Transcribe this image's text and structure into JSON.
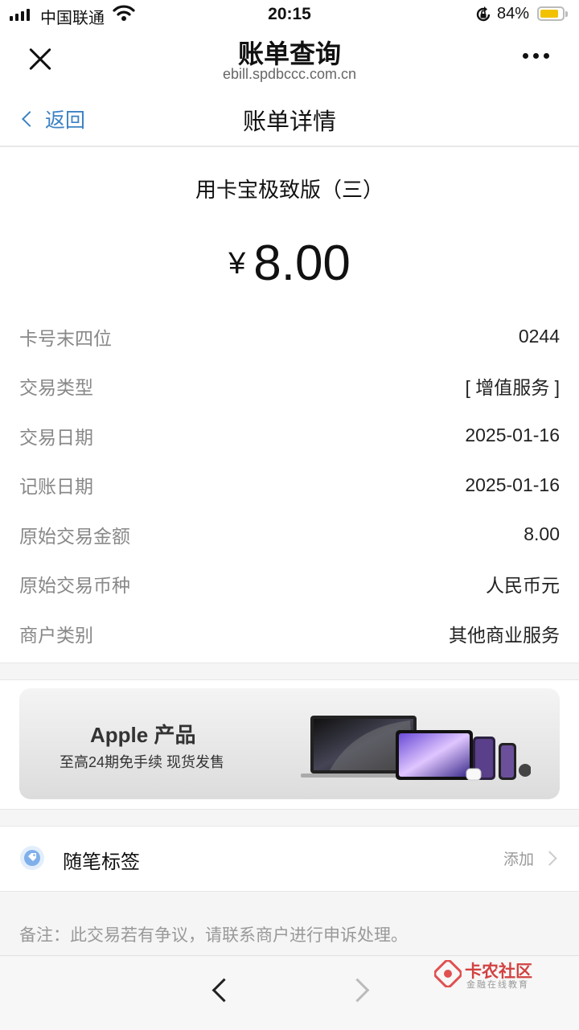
{
  "status_bar": {
    "carrier": "中国联通",
    "time": "20:15",
    "battery": "84%",
    "battery_level": 0.84
  },
  "header": {
    "title": "账单查询",
    "domain": "ebill.spdbccc.com.cn"
  },
  "nav": {
    "back_label": "返回",
    "title": "账单详情"
  },
  "bill": {
    "product": "用卡宝极致版（三）",
    "currency_symbol": "¥",
    "amount": "8.00",
    "rows": [
      {
        "label": "卡号末四位",
        "value": "0244"
      },
      {
        "label": "交易类型",
        "value": "[ 增值服务 ]"
      },
      {
        "label": "交易日期",
        "value": "2025-01-16"
      },
      {
        "label": "记账日期",
        "value": "2025-01-16"
      },
      {
        "label": "原始交易金额",
        "value": "8.00"
      },
      {
        "label": "原始交易币种",
        "value": "人民币元"
      },
      {
        "label": "商户类别",
        "value": "其他商业服务"
      }
    ]
  },
  "banner": {
    "title": "Apple 产品",
    "subtitle": "至高24期免手续 现货发售"
  },
  "tag": {
    "label": "随笔标签",
    "action": "添加"
  },
  "note": "备注：此交易若有争议，请联系商户进行申诉处理。",
  "watermark": {
    "name": "卡农社区",
    "sub": "金融在线教育"
  },
  "colors": {
    "link": "#3b82c4",
    "battery": "#f2c200",
    "watermark": "#cc2222"
  }
}
